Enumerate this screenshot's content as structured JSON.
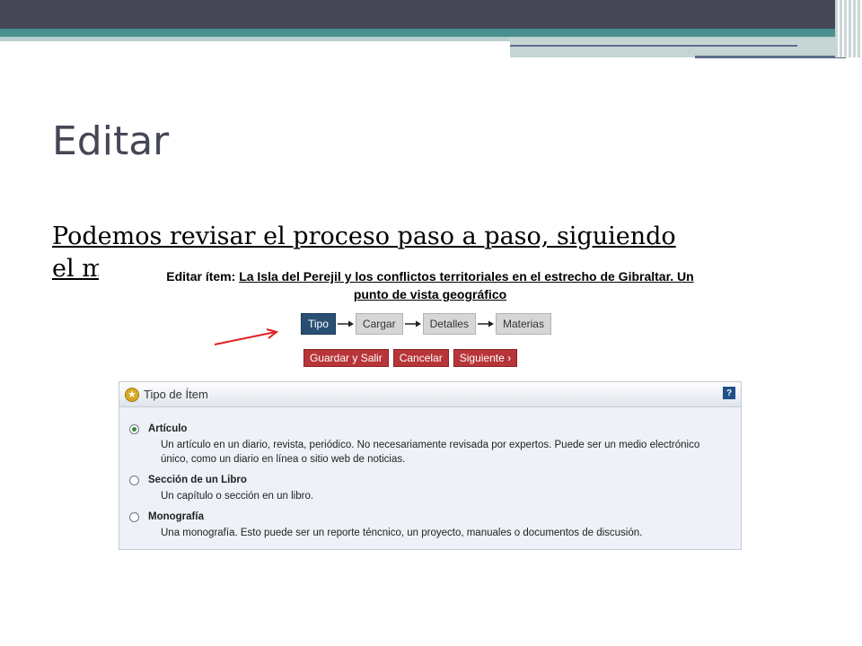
{
  "slide": {
    "title": "Editar",
    "body_line1": "Podemos revisar el proceso paso a paso, siguiendo",
    "body_line2": "el m"
  },
  "screenshot": {
    "heading_prefix": "Editar ítem:",
    "item_title_line1": "La Isla del Perejil y los conflictos territoriales en el estrecho de Gibraltar. Un",
    "item_title_line2": "punto de vista geográfico",
    "steps": [
      "Tipo",
      "Cargar",
      "Detalles",
      "Materias"
    ],
    "active_step": "Tipo",
    "buttons": {
      "save_exit": "Guardar y Salir",
      "cancel": "Cancelar",
      "next": "Siguiente ›"
    },
    "panel": {
      "title": "Tipo de Ítem",
      "help": "?",
      "options": [
        {
          "label": "Artículo",
          "checked": true,
          "desc": "Un artículo en un diario, revista, periódico. No necesariamente revisada por expertos. Puede ser un medio electrónico único, como un diario en línea o sitio web de noticias."
        },
        {
          "label": "Sección de un Libro",
          "checked": false,
          "desc": "Un capítulo o sección en un libro."
        },
        {
          "label": "Monografía",
          "checked": false,
          "desc": "Una monografía. Esto puede ser un reporte téncnico, un proyecto, manuales o documentos de discusión."
        }
      ]
    }
  },
  "colors": {
    "topbar": "#454756",
    "teal": "#4a8f8f",
    "active_step": "#2a4f75",
    "button_red": "#b73539",
    "annotation_arrow": "#e02020"
  }
}
